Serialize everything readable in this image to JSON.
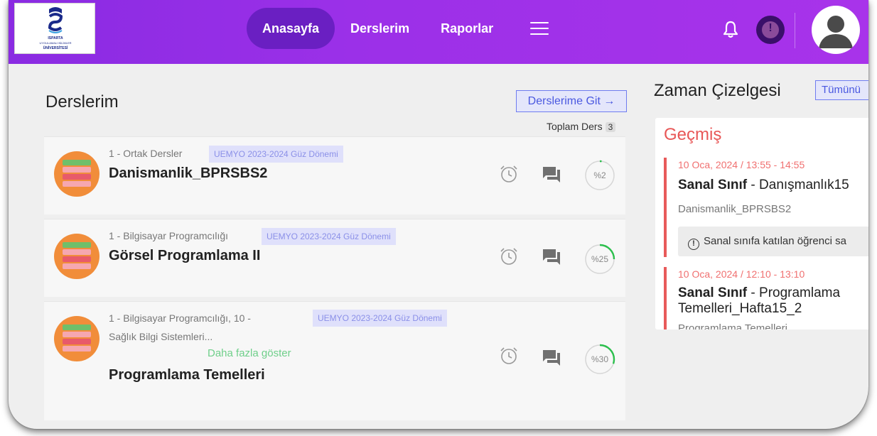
{
  "header": {
    "logo": {
      "line1": "ISPARTA",
      "line2": "UYGULAMALI BİLİMLER",
      "line3": "ÜNİVERSİTESİ"
    },
    "nav": [
      {
        "label": "Anasayfa",
        "active": true
      },
      {
        "label": "Derslerim",
        "active": false
      },
      {
        "label": "Raporlar",
        "active": false
      }
    ],
    "alert_label": "!",
    "icons": [
      "menu-icon",
      "bell-icon",
      "alert-icon",
      "user-avatar-icon"
    ]
  },
  "courses_section": {
    "title": "Derslerim",
    "goto_label": "Derslerime Git →",
    "total_label": "Toplam Ders",
    "total_count": "3",
    "courses": [
      {
        "category": "1 - Ortak Dersler",
        "term": "UEMYO 2023-2024 Güz Dönemi",
        "title": "Danismanlik_BPRSBS2",
        "progress_label": "%2",
        "progress": 0.02
      },
      {
        "category": "1 - Bilgisayar Programcılığı",
        "term": "UEMYO 2023-2024 Güz Dönemi",
        "title": "Görsel Programlama II",
        "progress_label": "%25",
        "progress": 0.25
      },
      {
        "category": "1 - Bilgisayar Programcılığı, 10 -",
        "category2": "Sağlık Bilgi Sistemleri...",
        "more_label": "Daha fazla göster",
        "term": "UEMYO 2023-2024 Güz Dönemi",
        "title": "Programlama Temelleri",
        "progress_label": "%30",
        "progress": 0.3
      }
    ]
  },
  "timeline": {
    "title": "Zaman Çizelgesi",
    "all_label": "Tümünü",
    "past_label": "Geçmiş",
    "events": [
      {
        "time": "10 Oca, 2024 / 13:55 - 14:55",
        "title_bold": "Sanal Sınıf",
        "title_rest": " - Danışmanlık15",
        "course": "Danismanlik_BPRSBS2",
        "note": "Sanal sınıfa katılan öğrenci sa"
      },
      {
        "time": "10 Oca, 2024 / 12:10 - 13:10",
        "title_bold": "Sanal Sınıf",
        "title_rest": " - Programlama Temelleri_Hafta15_2",
        "course": "Programlama Temelleri"
      }
    ]
  },
  "colors": {
    "header": "#9b30e8",
    "active_nav": "#6a1fc2",
    "accent_blue": "#4a58e0",
    "past_red": "#e85757",
    "progress_green": "#2cbf4d",
    "course_icon": "#f18d3a"
  }
}
